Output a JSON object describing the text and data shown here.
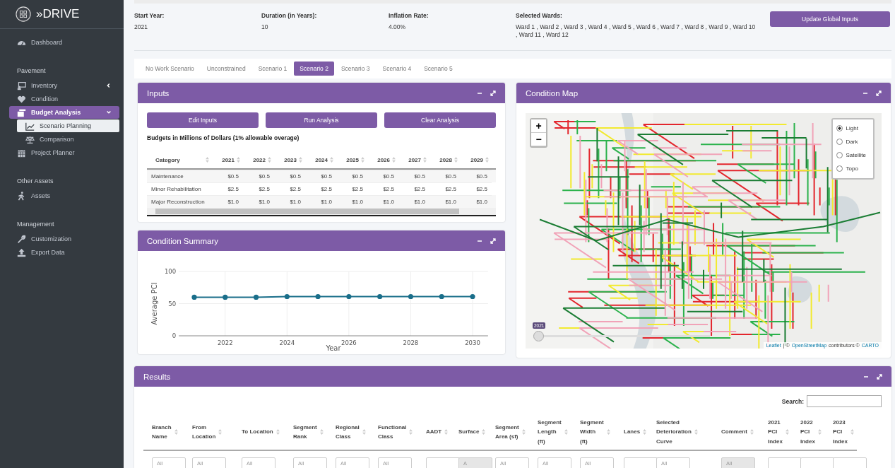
{
  "sidebar": {
    "logo": "»DRIVE",
    "sections": [
      {
        "items": [
          {
            "label": "Dashboard",
            "selected": false
          }
        ]
      },
      {
        "title": "Pavement",
        "items": [
          {
            "label": "Inventory",
            "selected": false,
            "expanded": false
          },
          {
            "label": "Condition",
            "selected": false
          },
          {
            "label": "Budget Analysis",
            "selected": true,
            "expanded": true,
            "children": [
              {
                "label": "Scenario Planning",
                "selected": true
              },
              {
                "label": "Comparison",
                "selected": false
              }
            ]
          },
          {
            "label": "Project Planner",
            "selected": false
          }
        ]
      },
      {
        "title": "Other Assets",
        "items": [
          {
            "label": "Assets",
            "selected": false
          }
        ]
      },
      {
        "title": "Management",
        "items": [
          {
            "label": "Customization",
            "selected": false
          },
          {
            "label": "Export Data",
            "selected": false
          }
        ]
      }
    ]
  },
  "global_inputs": {
    "fields": [
      {
        "label": "Start Year:",
        "value": "2021"
      },
      {
        "label": "Duration (in Years):",
        "value": "10"
      },
      {
        "label": "Inflation Rate:",
        "value": "4.00%"
      },
      {
        "label": "Selected Wards:",
        "value": "Ward 1 , Ward 2 , Ward 3 , Ward 4 , Ward 5 , Ward 6 , Ward 7 , Ward 8 , Ward 9 , Ward 10 , Ward 11 , Ward 12"
      }
    ],
    "button": "Update Global Inputs"
  },
  "tabs": [
    {
      "label": "No Work Scenario",
      "selected": false
    },
    {
      "label": "Unconstrained",
      "selected": false
    },
    {
      "label": "Scenario 1",
      "selected": false
    },
    {
      "label": "Scenario 2",
      "selected": true
    },
    {
      "label": "Scenario 3",
      "selected": false
    },
    {
      "label": "Scenario 4",
      "selected": false
    },
    {
      "label": "Scenario 5",
      "selected": false
    }
  ],
  "inputs": {
    "title": "Inputs",
    "buttons": [
      "Edit Inputs",
      "Run Analysis",
      "Clear Analysis"
    ],
    "caption": "Budgets in Millions of Dollars (1% allowable overage)",
    "columns": [
      "Category",
      "2021",
      "2022",
      "2023",
      "2024",
      "2025",
      "2026",
      "2027",
      "2028",
      "2029"
    ],
    "rows": [
      [
        "Maintenance",
        "$0.5",
        "$0.5",
        "$0.5",
        "$0.5",
        "$0.5",
        "$0.5",
        "$0.5",
        "$0.5",
        "$0.5"
      ],
      [
        "Minor Rehabilitation",
        "$2.5",
        "$2.5",
        "$2.5",
        "$2.5",
        "$2.5",
        "$2.5",
        "$2.5",
        "$2.5",
        "$2.5"
      ],
      [
        "Major Reconstruction",
        "$1.0",
        "$1.0",
        "$1.0",
        "$1.0",
        "$1.0",
        "$1.0",
        "$1.0",
        "$1.0",
        "$1.0"
      ]
    ]
  },
  "condition_summary": {
    "title": "Condition Summary",
    "chart_data": {
      "type": "line",
      "xlabel": "Year",
      "ylabel": "Average PCI",
      "x": [
        2021,
        2022,
        2023,
        2024,
        2025,
        2026,
        2027,
        2028,
        2029,
        2030
      ],
      "series": [
        {
          "color": "#1a6e8a",
          "marker": "circle",
          "values": [
            60,
            60,
            60,
            61,
            61,
            61,
            61,
            61,
            61,
            61
          ]
        }
      ],
      "xlim": [
        2020.5,
        2030.5
      ],
      "ylim": [
        0,
        100
      ],
      "xticks": [
        2022,
        2024,
        2026,
        2028,
        2030
      ],
      "yticks": [
        0,
        50,
        100
      ],
      "grid": true
    }
  },
  "condition_map": {
    "title": "Condition Map",
    "layers": [
      {
        "label": "Light",
        "selected": true
      },
      {
        "label": "Dark",
        "selected": false
      },
      {
        "label": "Satellite",
        "selected": false
      },
      {
        "label": "Topo",
        "selected": false
      }
    ],
    "zoom_in": "+",
    "zoom_out": "−",
    "slider": {
      "label": "2021",
      "level": 0
    },
    "attribution": [
      {
        "text": "Leaflet",
        "link": true
      },
      {
        "text": "| ©",
        "link": false
      },
      {
        "text": "OpenStreetMap",
        "link": true
      },
      {
        "text": "contributors ©",
        "link": false
      },
      {
        "text": "CARTO",
        "link": true
      }
    ]
  },
  "results": {
    "title": "Results",
    "search_label": "Search:",
    "columns": [
      {
        "label": "Branch\nName",
        "placeholder": "All",
        "disabled": false
      },
      {
        "label": "From\nLocation",
        "placeholder": "All",
        "disabled": false
      },
      {
        "label": "To Location",
        "placeholder": "All",
        "disabled": false
      },
      {
        "label": "Segment\nRank",
        "placeholder": "All",
        "disabled": false
      },
      {
        "label": "Regional\nClass",
        "placeholder": "All",
        "disabled": false
      },
      {
        "label": "Functional\nClass",
        "placeholder": "All",
        "disabled": false
      },
      {
        "label": "AADT",
        "disabled": false
      },
      {
        "label": "Surface",
        "placeholder": "A",
        "disabled": true
      },
      {
        "label": "Segment\nArea (sf)",
        "placeholder": "All",
        "disabled": false
      },
      {
        "label": "Segment\nLength\n(ft)",
        "placeholder": "All",
        "disabled": false
      },
      {
        "label": "Segment\nWidth\n(ft)",
        "placeholder": "All",
        "disabled": false
      },
      {
        "label": "Lanes",
        "disabled": false
      },
      {
        "label": "Selected\nDeterioration\nCurve",
        "placeholder": "All",
        "disabled": false
      },
      {
        "label": "Comment",
        "placeholder": "All",
        "disabled": true
      },
      {
        "label": "2021\nPCI\nIndex",
        "disabled": false
      },
      {
        "label": "2022\nPCI\nIndex",
        "disabled": false
      },
      {
        "label": "2023\nPCI\nIndex",
        "disabled": false
      }
    ]
  }
}
